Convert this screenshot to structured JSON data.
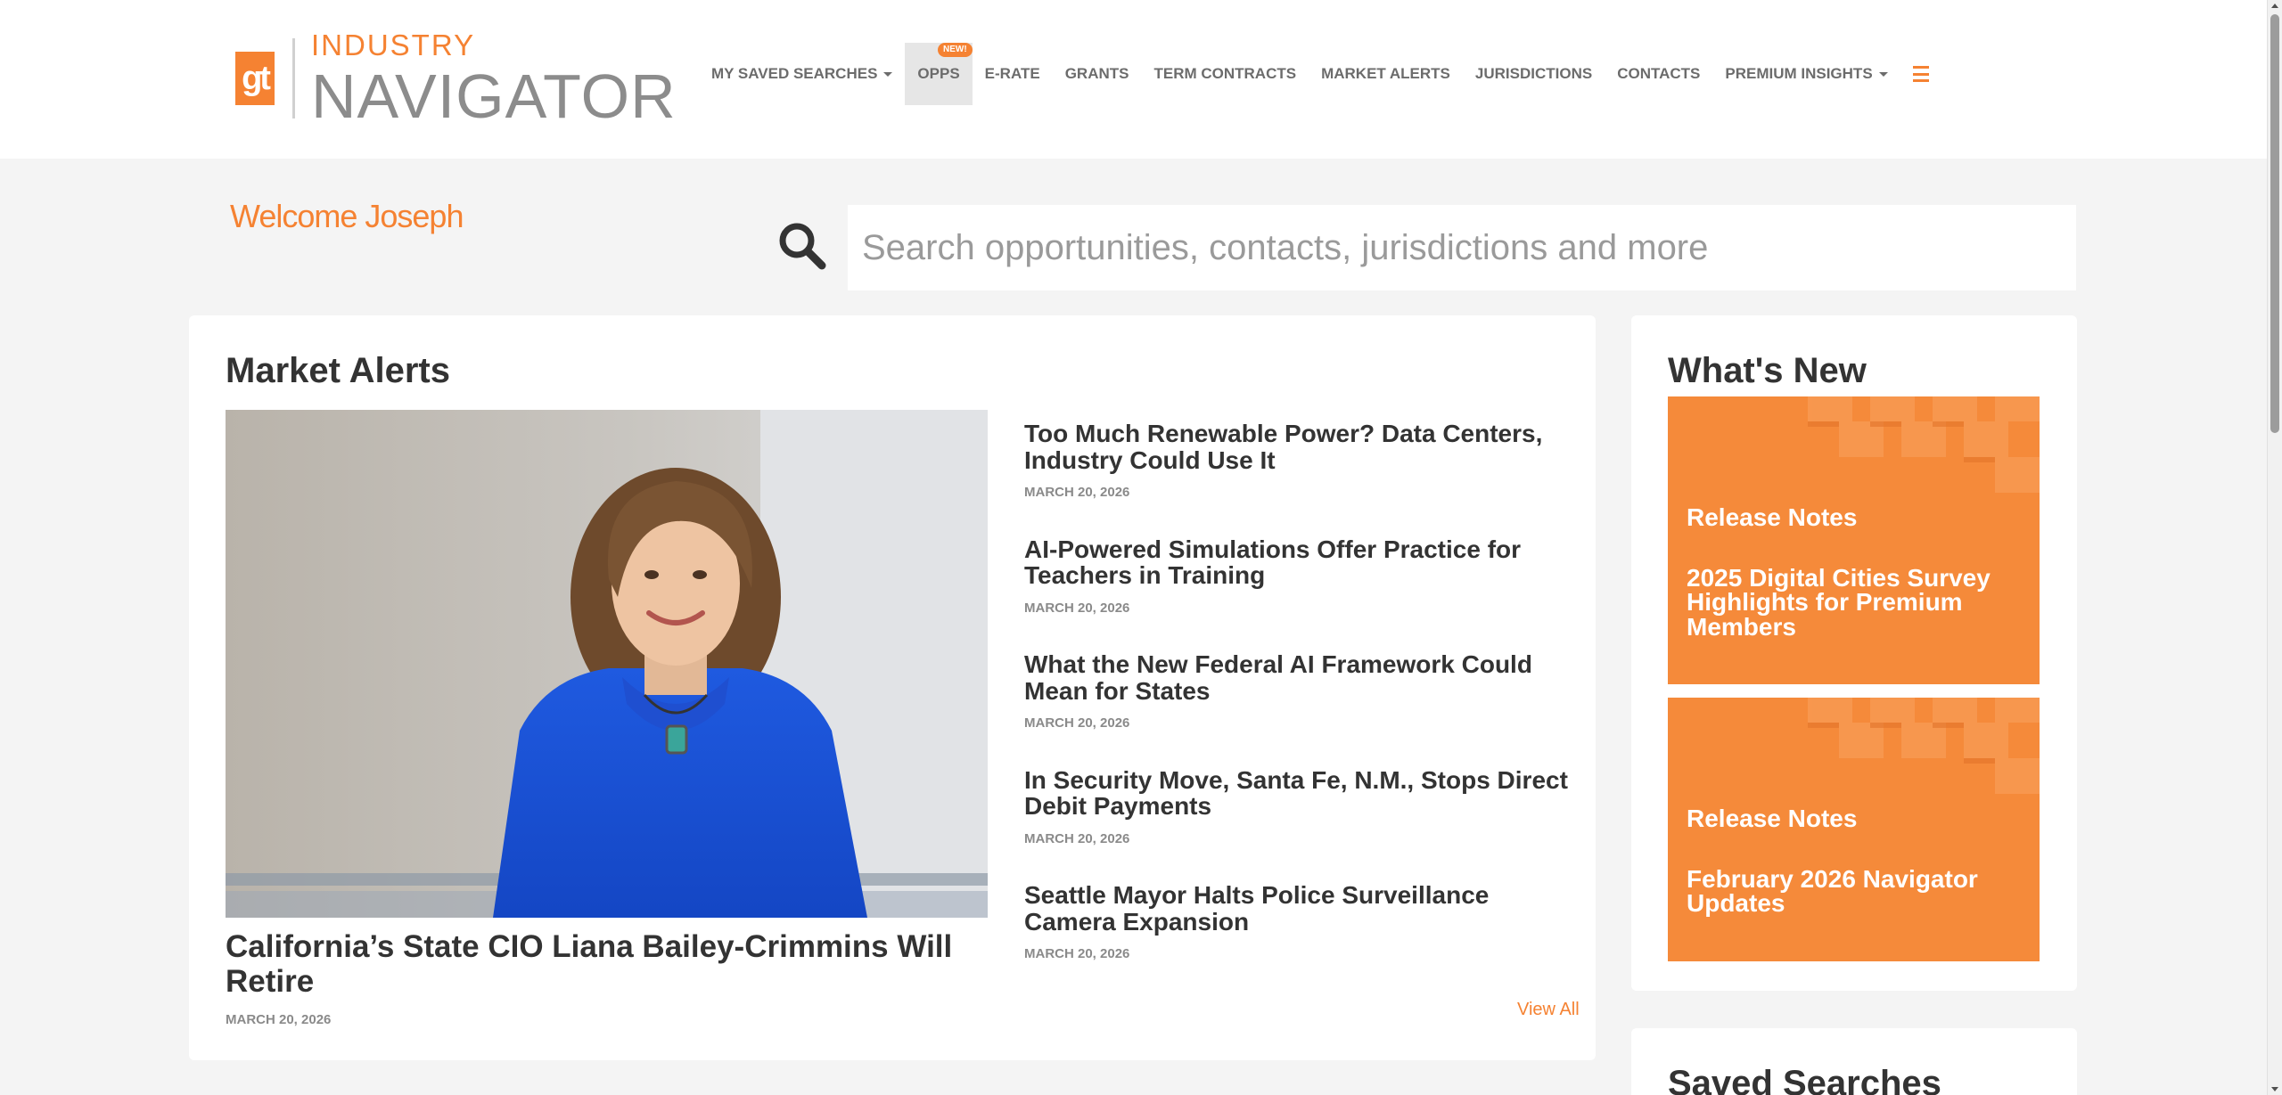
{
  "colors": {
    "accent": "#f58232",
    "tile": "#f58a3a",
    "text": "#333333",
    "muted": "#8a8a8a",
    "page_bg": "#f4f4f4"
  },
  "logo": {
    "mark": "gt",
    "top": "INDUSTRY",
    "bottom": "NAVIGATOR"
  },
  "nav": {
    "saved_searches": "MY SAVED SEARCHES",
    "opps": "OPPS",
    "opps_badge": "NEW!",
    "erate": "E-RATE",
    "grants": "GRANTS",
    "term_contracts": "TERM CONTRACTS",
    "market_alerts": "MARKET ALERTS",
    "jurisdictions": "JURISDICTIONS",
    "contacts": "CONTACTS",
    "premium_insights": "PREMIUM INSIGHTS",
    "menu_icon": "hamburger-icon"
  },
  "welcome": "Welcome Joseph",
  "search": {
    "placeholder": "Search opportunities, contacts, jurisdictions and more",
    "value": "",
    "icon": "search-icon"
  },
  "market_alerts": {
    "title": "Market Alerts",
    "featured": {
      "title": "California’s State CIO Liana Bailey-Crimmins Will Retire",
      "date": "MARCH 20, 2026"
    },
    "items": [
      {
        "title": "Too Much Renewable Power? Data Centers, Industry Could Use It",
        "date": "MARCH 20, 2026"
      },
      {
        "title": "AI-Powered Simulations Offer Practice for Teachers in Training",
        "date": "MARCH 20, 2026"
      },
      {
        "title": "What the New Federal AI Framework Could Mean for States",
        "date": "MARCH 20, 2026"
      },
      {
        "title": "In Security Move, Santa Fe, N.M., Stops Direct Debit Payments",
        "date": "MARCH 20, 2026"
      },
      {
        "title": "Seattle Mayor Halts Police Surveillance Camera Expansion",
        "date": "MARCH 20, 2026"
      }
    ],
    "view_all": "View All"
  },
  "whats_new": {
    "title": "What's New",
    "tiles": [
      {
        "label": "Release Notes",
        "text": "2025 Digital Cities Survey Highlights for Premium Members"
      },
      {
        "label": "Release Notes",
        "text": "February 2026 Navigator Updates"
      }
    ]
  },
  "saved_searches": {
    "title": "Saved Searches"
  }
}
